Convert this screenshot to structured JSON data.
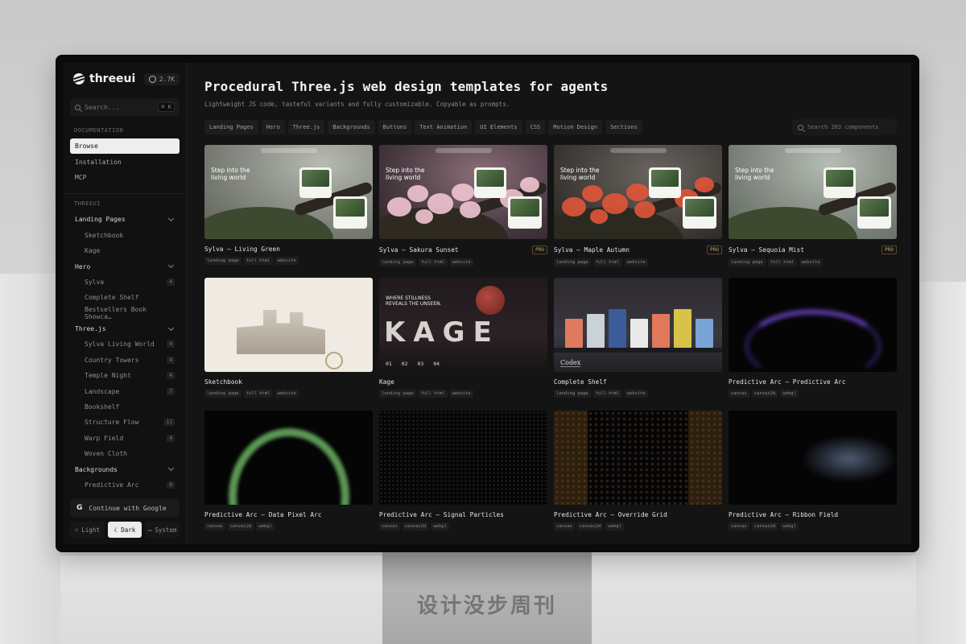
{
  "watermark": "设计没步周刊",
  "sidebar": {
    "brand": "threeui",
    "github_stars": "2.7K",
    "search_placeholder": "Search...",
    "search_shortcut": "⌘ K",
    "documentation_label": "DOCUMENTATION",
    "docs": [
      {
        "label": "Browse",
        "active": true
      },
      {
        "label": "Installation",
        "active": false
      },
      {
        "label": "MCP",
        "active": false
      }
    ],
    "threeui_label": "THREEUI",
    "nav": [
      {
        "label": "Landing Pages",
        "type": "group",
        "count": ""
      },
      {
        "label": "Sketchbook",
        "type": "sub",
        "count": ""
      },
      {
        "label": "Kage",
        "type": "sub",
        "count": ""
      },
      {
        "label": "Hero",
        "type": "group",
        "count": ""
      },
      {
        "label": "Sylva",
        "type": "sub",
        "count": "4"
      },
      {
        "label": "Complete Shelf",
        "type": "sub",
        "count": ""
      },
      {
        "label": "Bestsellers Book Showca…",
        "type": "sub",
        "count": ""
      },
      {
        "label": "Three.js",
        "type": "group",
        "count": ""
      },
      {
        "label": "Sylva Living World",
        "type": "sub",
        "count": "4"
      },
      {
        "label": "Country Towers",
        "type": "sub",
        "count": "4"
      },
      {
        "label": "Temple Night",
        "type": "sub",
        "count": "4"
      },
      {
        "label": "Landscape",
        "type": "sub",
        "count": "7"
      },
      {
        "label": "Bookshelf",
        "type": "sub",
        "count": ""
      },
      {
        "label": "Structure Flow",
        "type": "sub",
        "count": "11"
      },
      {
        "label": "Warp Field",
        "type": "sub",
        "count": "4"
      },
      {
        "label": "Woven Cloth",
        "type": "sub",
        "count": ""
      },
      {
        "label": "Backgrounds",
        "type": "group",
        "count": ""
      },
      {
        "label": "Predictive Arc",
        "type": "sub",
        "count": "8"
      }
    ],
    "google_button": "Continue with Google",
    "theme": [
      {
        "label": "Light",
        "icon": "☼",
        "active": false
      },
      {
        "label": "Dark",
        "icon": "☾",
        "active": true
      },
      {
        "label": "System",
        "icon": "▭",
        "active": false
      }
    ]
  },
  "main": {
    "title": "Procedural Three.js web design templates for agents",
    "subtitle": "Lightweight JS code, tasteful variants and fully customizable. Copyable as prompts.",
    "chips": [
      "Landing Pages",
      "Hero",
      "Three.js",
      "Backgrounds",
      "Buttons",
      "Text Animation",
      "UI Elements",
      "CSS",
      "Motion Design",
      "Sections"
    ],
    "component_search_placeholder": "Search 263 components",
    "cards": [
      {
        "title": "Sylva — Living Green",
        "pro": "",
        "tags": [
          "landing page",
          "full html",
          "website"
        ],
        "thumb": "living",
        "hero": "Step into the living world"
      },
      {
        "title": "Sylva — Sakura Sunset",
        "pro": "PRO",
        "tags": [
          "landing page",
          "full html",
          "website"
        ],
        "thumb": "sakura",
        "hero": "Step into the living world"
      },
      {
        "title": "Sylva — Maple Autumn",
        "pro": "PRO",
        "tags": [
          "landing page",
          "full html",
          "website"
        ],
        "thumb": "maple",
        "hero": "Step into the living world"
      },
      {
        "title": "Sylva — Sequoia Mist",
        "pro": "PRO",
        "tags": [
          "landing page",
          "full html",
          "website"
        ],
        "thumb": "sequoia",
        "hero": "Step into the living world"
      },
      {
        "title": "Sketchbook",
        "pro": "",
        "tags": [
          "landing page",
          "full html",
          "website"
        ],
        "thumb": "sketch",
        "hero": ""
      },
      {
        "title": "Kage",
        "pro": "",
        "tags": [
          "landing page",
          "full html",
          "website"
        ],
        "thumb": "kage",
        "hero": "WHERE STILLNESS REVEALS THE UNSEEN.",
        "big": "KAGE",
        "nums": "01 02 03 04"
      },
      {
        "title": "Complete Shelf",
        "pro": "",
        "tags": [
          "landing page",
          "full html",
          "website"
        ],
        "thumb": "shelf",
        "hero": "Codex"
      },
      {
        "title": "Predictive Arc — Predictive Arc",
        "pro": "",
        "tags": [
          "canvas",
          "canvas2d",
          "webgl"
        ],
        "thumb": "arc-purple",
        "hero": ""
      },
      {
        "title": "Predictive Arc — Data Pixel Arc",
        "pro": "",
        "tags": [
          "canvas",
          "canvas2d",
          "webgl"
        ],
        "thumb": "arc-green",
        "hero": ""
      },
      {
        "title": "Predictive Arc — Signal Particles",
        "pro": "",
        "tags": [
          "canvas",
          "canvas2d",
          "webgl"
        ],
        "thumb": "arc-dots",
        "hero": ""
      },
      {
        "title": "Predictive Arc — Override Grid",
        "pro": "",
        "tags": [
          "canvas",
          "canvas2d",
          "webgl"
        ],
        "thumb": "arc-grid",
        "hero": ""
      },
      {
        "title": "Predictive Arc — Ribbon Field",
        "pro": "",
        "tags": [
          "canvas",
          "canvas2d",
          "webgl"
        ],
        "thumb": "arc-ribbon",
        "hero": ""
      }
    ]
  },
  "colors": {
    "screen_bg": "#141414",
    "sidebar_bg": "#111111",
    "active_item_bg": "#eeeeee",
    "pro_badge": "#c8a66a"
  }
}
